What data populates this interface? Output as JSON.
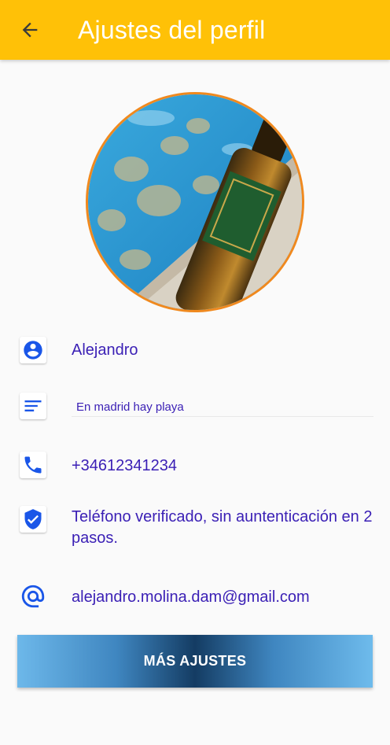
{
  "header": {
    "title": "Ajustes del perfil",
    "back_icon": "arrow-back-icon",
    "color": "#ffc107"
  },
  "profile": {
    "name": "Alejandro",
    "bio": "En madrid hay playa",
    "phone": "+34612341234",
    "verification": "Teléfono verificado, sin auntenticación en 2 pasos.",
    "email": "alejandro.molina.dam@gmail.com"
  },
  "icons": {
    "name": "account-circle-icon",
    "bio": "subject-lines-icon",
    "phone": "phone-icon",
    "verification": "verified-shield-icon",
    "email": "at-sign-icon"
  },
  "actions": {
    "more_settings": "MÁS AJUSTES"
  },
  "colors": {
    "accent_text": "#3a1fb5",
    "icon_blue": "#1a56e8",
    "avatar_border": "#f0891e"
  }
}
